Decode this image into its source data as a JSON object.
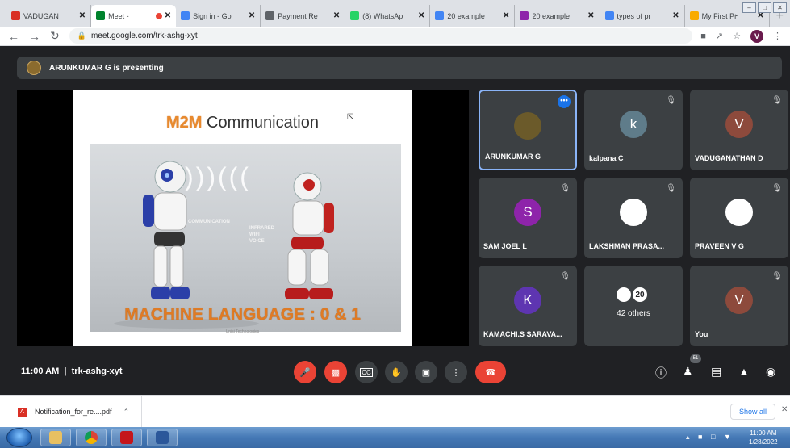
{
  "browser": {
    "tabs": [
      {
        "title": "VADUGAN",
        "icon": "gmail-icon",
        "color": "#d93025"
      },
      {
        "title": "Meet -",
        "icon": "meet-icon",
        "color": "#00832d",
        "active": true
      },
      {
        "title": "Sign in - Go",
        "icon": "google-icon",
        "color": "#4285f4"
      },
      {
        "title": "Payment Re",
        "icon": "globe-icon",
        "color": "#5f6368"
      },
      {
        "title": "(8) WhatsAp",
        "icon": "whatsapp-icon",
        "color": "#25d366"
      },
      {
        "title": "20 example",
        "icon": "google-icon",
        "color": "#4285f4"
      },
      {
        "title": "20 example",
        "icon": "site-icon",
        "color": "#8e24aa"
      },
      {
        "title": "types of pr",
        "icon": "google-icon",
        "color": "#4285f4"
      },
      {
        "title": "My First Pr",
        "icon": "site-icon",
        "color": "#f9ab00"
      }
    ],
    "url": "meet.google.com/trk-ashg-xyt",
    "profile_initial": "V"
  },
  "meet": {
    "presenting_text": "ARUNKUMAR G is presenting",
    "slide": {
      "title_accent": "M2M",
      "title_rest": " Communication",
      "wave_words": [
        "COMMUNICATION",
        "INFRARED",
        "WIFI",
        "VOICE"
      ],
      "footer_text": "MACHINE LANGUAGE : 0 & 1",
      "credit": "Unisi Technologies"
    },
    "participants": [
      {
        "name": "ARUNKUMAR G",
        "avatar": "",
        "avatar_color": "#6b5a2a",
        "active": true,
        "more": true
      },
      {
        "name": "kalpana C",
        "avatar": "k",
        "avatar_color": "#5f7c8a"
      },
      {
        "name": "VADUGANATHAN D",
        "avatar": "V",
        "avatar_color": "#8d4a3c"
      },
      {
        "name": "SAM JOEL L",
        "avatar": "S",
        "avatar_color": "#8e24aa"
      },
      {
        "name": "LAKSHMAN PRASA...",
        "avatar": "",
        "avatar_color": "#ffffff"
      },
      {
        "name": "PRAVEEN V G",
        "avatar": "",
        "avatar_color": "#ffffff"
      },
      {
        "name": "KAMACHI.S SARAVA...",
        "avatar": "K",
        "avatar_color": "#5e35b1"
      },
      {
        "name": "",
        "others_label": "42 others",
        "others_badge": "20"
      },
      {
        "name": "You",
        "avatar": "V",
        "avatar_color": "#8d4a3c"
      }
    ],
    "time": "11:00 AM",
    "meeting_code": "trk-ashg-xyt",
    "people_count": "51"
  },
  "downloads": {
    "file": "Notification_for_re....pdf",
    "show_all": "Show all"
  },
  "taskbar": {
    "time": "11:00 AM",
    "date": "1/28/2022"
  }
}
